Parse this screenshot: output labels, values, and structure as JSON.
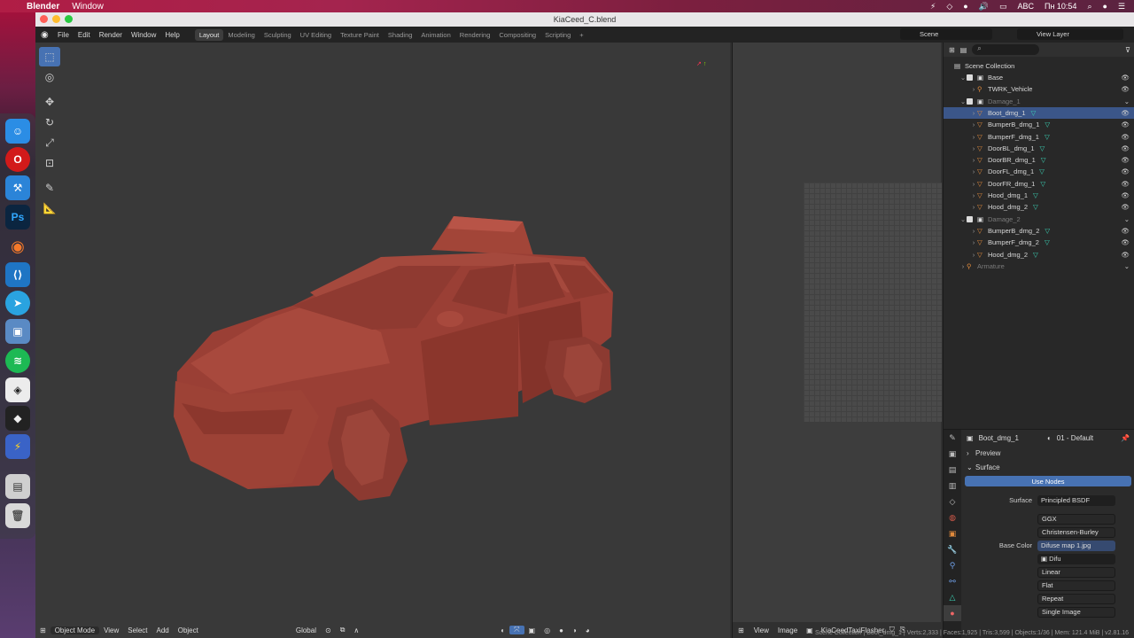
{
  "menubar": {
    "app": "Blender",
    "items": [
      "Window"
    ],
    "language": "ABC",
    "clock": "Пн 10:54"
  },
  "window": {
    "title": "KiaCeed_C.blend"
  },
  "topbar": {
    "menus": [
      "File",
      "Edit",
      "Render",
      "Window",
      "Help"
    ],
    "workspaces": [
      "Layout",
      "Modeling",
      "Sculpting",
      "UV Editing",
      "Texture Paint",
      "Shading",
      "Animation",
      "Rendering",
      "Compositing",
      "Scripting"
    ],
    "active_workspace": "Layout",
    "add_tab": "+",
    "scene": "Scene",
    "view_layer": "View Layer"
  },
  "viewport": {
    "mode": "Object Mode",
    "menus": [
      "View",
      "Select",
      "Add",
      "Object"
    ],
    "transform": "Global"
  },
  "image_editor": {
    "menus": [
      "View",
      "Image"
    ],
    "image_name": "KiaCeedTaxiFlasher..."
  },
  "outliner": {
    "root": "Scene Collection",
    "rows": [
      {
        "label": "Base",
        "type": "collection",
        "indent": 1
      },
      {
        "label": "TWRK_Vehicle",
        "type": "armature",
        "indent": 2
      },
      {
        "label": "Damage_1",
        "type": "collection",
        "indent": 1,
        "dim": true
      },
      {
        "label": "Boot_dmg_1",
        "type": "mesh",
        "indent": 2,
        "selected": true
      },
      {
        "label": "BumperB_dmg_1",
        "type": "mesh",
        "indent": 2
      },
      {
        "label": "BumperF_dmg_1",
        "type": "mesh",
        "indent": 2
      },
      {
        "label": "DoorBL_dmg_1",
        "type": "mesh",
        "indent": 2
      },
      {
        "label": "DoorBR_dmg_1",
        "type": "mesh",
        "indent": 2
      },
      {
        "label": "DoorFL_dmg_1",
        "type": "mesh",
        "indent": 2
      },
      {
        "label": "DoorFR_dmg_1",
        "type": "mesh",
        "indent": 2
      },
      {
        "label": "Hood_dmg_1",
        "type": "mesh",
        "indent": 2
      },
      {
        "label": "Hood_dmg_2",
        "type": "mesh",
        "indent": 2
      },
      {
        "label": "Damage_2",
        "type": "collection",
        "indent": 1,
        "dim": true
      },
      {
        "label": "BumperB_dmg_2",
        "type": "mesh",
        "indent": 2
      },
      {
        "label": "BumperF_dmg_2",
        "type": "mesh",
        "indent": 2
      },
      {
        "label": "Hood_dmg_2",
        "type": "mesh",
        "indent": 2
      },
      {
        "label": "Armature",
        "type": "armature",
        "indent": 1,
        "dim": true
      }
    ]
  },
  "properties": {
    "object": "Boot_dmg_1",
    "material": "01 - Default",
    "preview_label": "Preview",
    "surface_section": "Surface",
    "use_nodes": "Use Nodes",
    "surface_label": "Surface",
    "surface_value": "Principled BSDF",
    "distribution": "GGX",
    "subsurface": "Christensen-Burley",
    "base_color_label": "Base Color",
    "base_color_value": "Difuse map 1.jpg",
    "image_short": "Difu",
    "interpolation": "Linear",
    "projection": "Flat",
    "extension": "Repeat",
    "source": "Single Image"
  },
  "status": {
    "text": "Scene Collection | Boot_dmg_1 | Verts:2,333 | Faces:1,925 | Tris:3,599 | Objects:1/36 | Mem: 121.4 MiB | v2.81.16"
  },
  "colors": {
    "accent": "#4772b3",
    "car": "#9b3f35",
    "selected_row": "#3b5689"
  }
}
